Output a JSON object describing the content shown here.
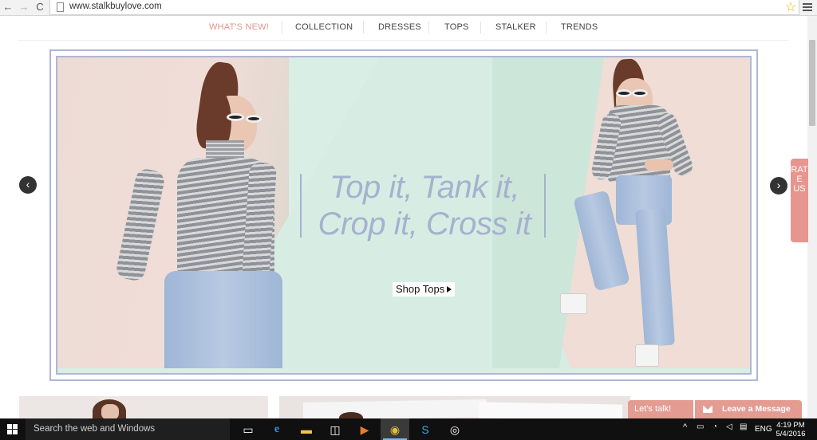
{
  "browser": {
    "url": "www.stalkbuylove.com",
    "back_glyph": "←",
    "forward_glyph": "→",
    "reload_glyph": "C",
    "star_glyph": "☆"
  },
  "nav": {
    "items": [
      {
        "label": "WHAT'S NEW!",
        "active": true
      },
      {
        "label": "COLLECTION"
      },
      {
        "label": "DRESSES"
      },
      {
        "label": "TOPS"
      },
      {
        "label": "STALKER"
      },
      {
        "label": "TRENDS"
      }
    ]
  },
  "banner": {
    "headline_line1": "Top it, Tank it,",
    "headline_line2": "Crop it, Cross it",
    "cta_label": "Shop Tops",
    "prev_glyph": "‹",
    "next_glyph": "›"
  },
  "rate_us": {
    "label": "RATE US"
  },
  "chat": {
    "lets_talk": "Let's talk!",
    "leave_message": "Leave a Message"
  },
  "taskbar": {
    "search_placeholder": "Search the web and Windows",
    "language": "ENG",
    "time": "4:19 PM",
    "date": "5/4/2016"
  },
  "colors": {
    "accent": "#e39b92",
    "headline": "#a6b1cf",
    "frame": "#aeb7d6"
  }
}
